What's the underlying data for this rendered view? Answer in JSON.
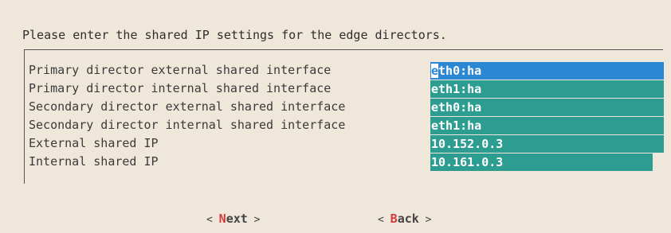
{
  "dialog": {
    "prompt": "Please enter the shared IP settings for the edge directors."
  },
  "form": {
    "rows": [
      {
        "label": "Primary director external shared interface",
        "value_first": "e",
        "value_rest": "th0:ha"
      },
      {
        "label": "Primary director internal shared interface",
        "value": "eth1:ha"
      },
      {
        "label": "Secondary director external shared interface",
        "value": "eth0:ha"
      },
      {
        "label": "Secondary director internal shared interface",
        "value": "eth1:ha"
      },
      {
        "label": "External shared IP",
        "value": "10.152.0.3"
      },
      {
        "label": "Internal shared IP",
        "value": "10.161.0.3"
      }
    ]
  },
  "buttons": {
    "next": {
      "open": "< ",
      "hotkey": "N",
      "rest": "ext",
      "close": " >"
    },
    "back": {
      "open": "< ",
      "hotkey": "B",
      "rest": "ack",
      "close": " >"
    }
  },
  "colors": {
    "background": "#efe8da",
    "field": "#2e9d91",
    "field_active": "#2b86d4",
    "hotkey": "#d33a3a"
  }
}
